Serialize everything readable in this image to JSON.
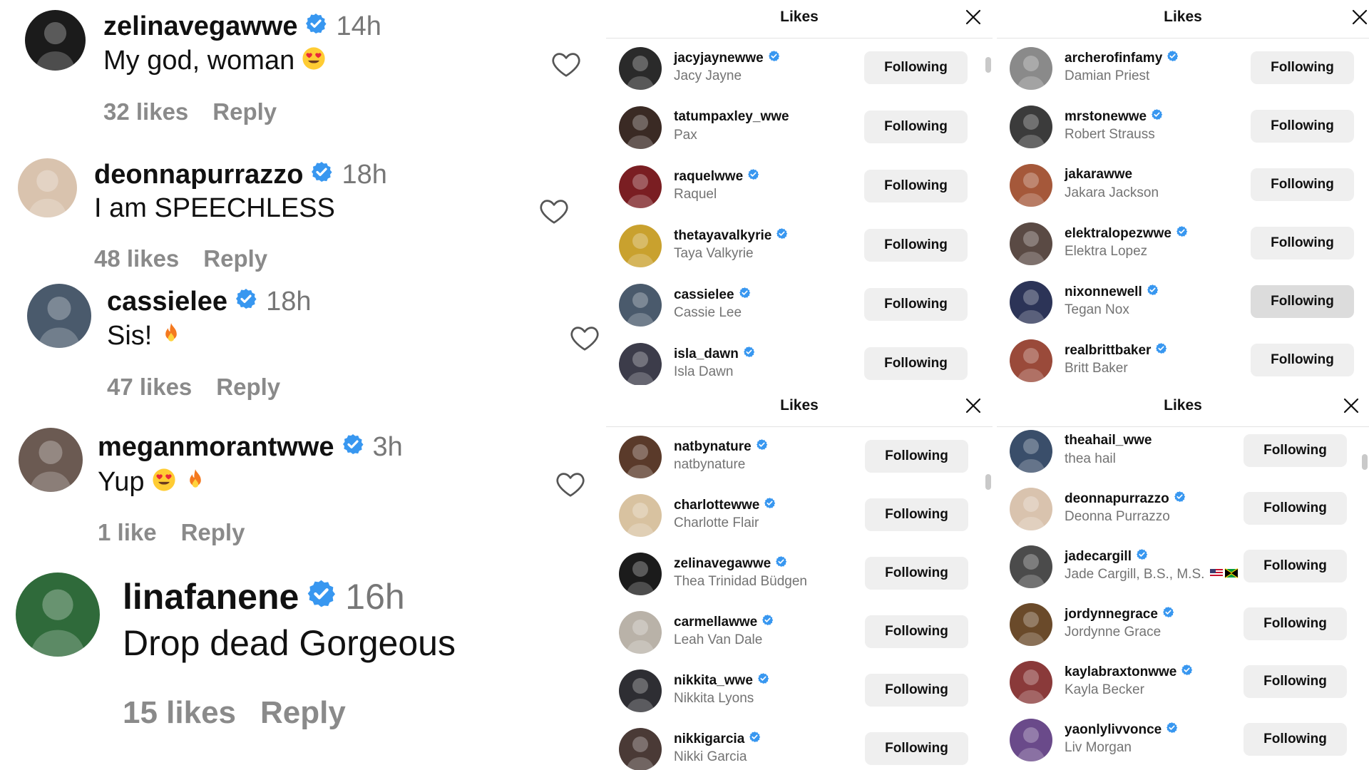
{
  "comments": [
    {
      "username": "zelinavegawwe",
      "verified": true,
      "time": "14h",
      "text": "My god, woman",
      "emoji": "heart-eyes",
      "likes": "32 likes",
      "reply": "Reply",
      "avatar_color": "#1b1b1b"
    },
    {
      "username": "deonnapurrazzo",
      "verified": true,
      "time": "18h",
      "text": "I am SPEECHLESS",
      "emoji": "",
      "likes": "48 likes",
      "reply": "Reply",
      "avatar_color": "#d9c3ae"
    },
    {
      "username": "cassielee",
      "verified": true,
      "time": "18h",
      "text": "Sis!",
      "emoji": "fire",
      "likes": "47 likes",
      "reply": "Reply",
      "avatar_color": "#4a5a6c"
    },
    {
      "username": "meganmorantwwe",
      "verified": true,
      "time": "3h",
      "text": "Yup",
      "emoji": "heart-eyes fire",
      "likes": "1 like",
      "reply": "Reply",
      "avatar_color": "#6b5a52"
    },
    {
      "username": "linafanene",
      "verified": true,
      "time": "16h",
      "text": "Drop dead Gorgeous",
      "emoji": "",
      "likes": "15 likes",
      "reply": "Reply",
      "avatar_color": "#2f6a3a"
    }
  ],
  "panels": [
    {
      "title": "Likes",
      "users": [
        {
          "username": "jacyjaynewwe",
          "name": "Jacy Jayne",
          "verified": true,
          "button": "Following",
          "avatar_color": "#2a2a2a"
        },
        {
          "username": "tatumpaxley_wwe",
          "name": "Pax",
          "verified": false,
          "button": "Following",
          "avatar_color": "#3a2a24"
        },
        {
          "username": "raquelwwe",
          "name": "Raquel",
          "verified": true,
          "button": "Following",
          "avatar_color": "#7a1e22"
        },
        {
          "username": "thetayavalkyrie",
          "name": "Taya Valkyrie",
          "verified": true,
          "button": "Following",
          "avatar_color": "#c9a12e"
        },
        {
          "username": "cassielee",
          "name": "Cassie Lee",
          "verified": true,
          "button": "Following",
          "avatar_color": "#4a5a6c"
        },
        {
          "username": "isla_dawn",
          "name": "Isla Dawn",
          "verified": true,
          "button": "Following",
          "avatar_color": "#3c3c4a"
        }
      ]
    },
    {
      "title": "Likes",
      "users": [
        {
          "username": "archerofinfamy",
          "name": "Damian Priest",
          "verified": true,
          "button": "Following",
          "avatar_color": "#8a8a8a"
        },
        {
          "username": "mrstonewwe",
          "name": "Robert Strauss",
          "verified": true,
          "button": "Following",
          "avatar_color": "#3b3b3b"
        },
        {
          "username": "jakarawwe",
          "name": "Jakara Jackson",
          "verified": false,
          "button": "Following",
          "avatar_color": "#a5583a"
        },
        {
          "username": "elektralopezwwe",
          "name": "Elektra Lopez",
          "verified": true,
          "button": "Following",
          "avatar_color": "#5a4a44"
        },
        {
          "username": "nixonnewell",
          "name": "Tegan Nox",
          "verified": true,
          "button": "Following",
          "avatar_color": "#2c3457"
        },
        {
          "username": "realbrittbaker",
          "name": "Britt Baker",
          "verified": true,
          "button": "Following",
          "avatar_color": "#9a4a3a"
        }
      ]
    },
    {
      "title": "Likes",
      "users": [
        {
          "username": "natbynature",
          "name": "natbynature",
          "verified": true,
          "button": "Following",
          "avatar_color": "#5a3a2a"
        },
        {
          "username": "charlottewwe",
          "name": "Charlotte Flair",
          "verified": true,
          "button": "Following",
          "avatar_color": "#d8c2a0"
        },
        {
          "username": "zelinavegawwe",
          "name": "Thea Trinidad Büdgen",
          "verified": true,
          "button": "Following",
          "avatar_color": "#1b1b1b"
        },
        {
          "username": "carmellawwe",
          "name": "Leah Van Dale",
          "verified": true,
          "button": "Following",
          "avatar_color": "#b9b2a8"
        },
        {
          "username": "nikkita_wwe",
          "name": "Nikkita Lyons",
          "verified": true,
          "button": "Following",
          "avatar_color": "#2e2e33"
        },
        {
          "username": "nikkigarcia",
          "name": "Nikki Garcia",
          "verified": true,
          "button": "Following",
          "avatar_color": "#4a3a36"
        }
      ]
    },
    {
      "title": "Likes",
      "users": [
        {
          "username": "theahail_wwe",
          "name": "thea hail",
          "verified": false,
          "button": "Following",
          "avatar_color": "#3a4e6a"
        },
        {
          "username": "deonnapurrazzo",
          "name": "Deonna Purrazzo",
          "verified": true,
          "button": "Following",
          "avatar_color": "#d9c3ae"
        },
        {
          "username": "jadecargill",
          "name": "Jade Cargill, B.S., M.S.",
          "verified": true,
          "button": "Following",
          "avatar_color": "#4b4b4b",
          "flags": "us jm"
        },
        {
          "username": "jordynnegrace",
          "name": "Jordynne Grace",
          "verified": true,
          "button": "Following",
          "avatar_color": "#6a4a2a"
        },
        {
          "username": "kaylabraxtonwwe",
          "name": "Kayla Becker",
          "verified": true,
          "button": "Following",
          "avatar_color": "#8a3a3a"
        },
        {
          "username": "yaonlylivvonce",
          "name": "Liv Morgan",
          "verified": true,
          "button": "Following",
          "avatar_color": "#6a4a8a"
        }
      ]
    }
  ],
  "colors": {
    "verified": "#3897f0",
    "button_bg": "#efefef",
    "muted": "#737373",
    "meta": "#8a8a8a"
  },
  "icons": {
    "heart": "heart-outline-icon",
    "close": "close-icon",
    "verified": "verified-badge-icon"
  }
}
